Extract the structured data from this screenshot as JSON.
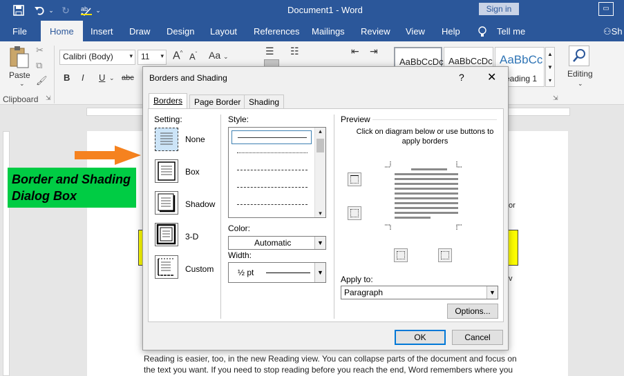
{
  "window": {
    "title": "Document1  -  Word",
    "sign_in": "Sign in"
  },
  "tabs": [
    "File",
    "Home",
    "Insert",
    "Draw",
    "Design",
    "Layout",
    "References",
    "Mailings",
    "Review",
    "View",
    "Help"
  ],
  "tell_me": "Tell me",
  "share": "Sh",
  "ribbon": {
    "paste_label": "Paste",
    "clipboard_label": "Clipboard",
    "font_name": "Calibri (Body)",
    "font_size": "11",
    "bold": "B",
    "italic": "I",
    "underline": "U",
    "strike": "abc",
    "grow_font": "A",
    "shrink_font": "A",
    "change_case": "Aa",
    "styles": [
      {
        "sample": "AaBbCcDc",
        "caption": ""
      },
      {
        "sample": "AaBbCcDc",
        "caption": ""
      },
      {
        "sample": "AaBbCc",
        "caption": "eading 1"
      }
    ],
    "editing_label": "Editing"
  },
  "annotation": {
    "label": "Border and Shading Dialog Box",
    "arrow_color": "#f5821f",
    "label_bg": "#00cc44"
  },
  "document": {
    "trailing_char": "or",
    "trailing_char2": "v",
    "body": "Reading is easier, too, in the new Reading view. You can collapse parts of the document and focus on the text you want. If you need to stop reading before you reach the end, Word remembers where you"
  },
  "dialog": {
    "title": "Borders and Shading",
    "help": "?",
    "close": "✕",
    "tabs": [
      "Borders",
      "Page Border",
      "Shading"
    ],
    "setting_label": "Setting:",
    "settings": [
      "None",
      "Box",
      "Shadow",
      "3-D",
      "Custom"
    ],
    "style_label": "Style:",
    "color_label": "Color:",
    "color_value": "Automatic",
    "width_label": "Width:",
    "width_value": "½ pt",
    "preview_label": "Preview",
    "preview_hint": "Click on diagram below or use buttons to apply borders",
    "apply_label": "Apply to:",
    "apply_value": "Paragraph",
    "options_button": "Options...",
    "ok_button": "OK",
    "cancel_button": "Cancel"
  },
  "colors": {
    "word_blue": "#2b579a",
    "highlight_yellow": "#ffff00"
  }
}
